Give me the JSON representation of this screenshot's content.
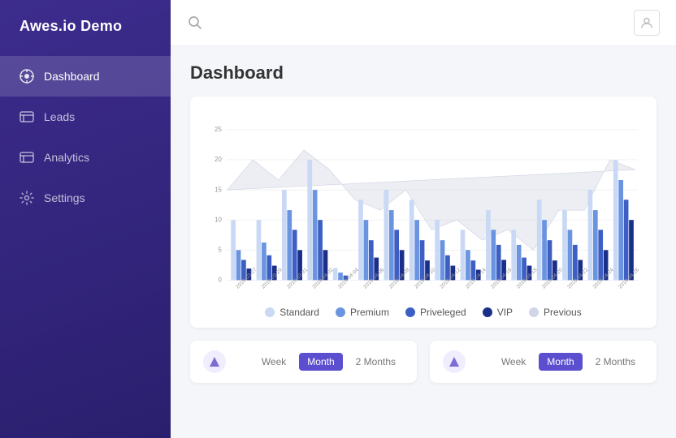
{
  "app": {
    "title": "Awes.io Demo"
  },
  "sidebar": {
    "items": [
      {
        "id": "dashboard",
        "label": "Dashboard",
        "active": true
      },
      {
        "id": "leads",
        "label": "Leads",
        "active": false
      },
      {
        "id": "analytics",
        "label": "Analytics",
        "active": false
      },
      {
        "id": "settings",
        "label": "Settings",
        "active": false
      }
    ]
  },
  "page": {
    "title": "Dashboard"
  },
  "chart": {
    "yAxisLabels": [
      "0",
      "5",
      "10",
      "15",
      "20",
      "25"
    ],
    "xAxisLabels": [
      "2019-03-27",
      "2019-03-29",
      "2019-03-31",
      "2019-04-02",
      "2019-04-04",
      "2019-04-06",
      "2019-04-08",
      "2019-04-10",
      "2019-04-12",
      "2019-04-14",
      "2019-04-16",
      "2019-04-18",
      "2019-04-20",
      "2019-04-22",
      "2019-04-24",
      "2019-04-26"
    ],
    "legend": [
      {
        "label": "Standard",
        "color": "#c9d9f5"
      },
      {
        "label": "Premium",
        "color": "#6b94e0"
      },
      {
        "label": "Priveleged",
        "color": "#3d5fc4"
      },
      {
        "label": "VIP",
        "color": "#1a2f8a"
      },
      {
        "label": "Previous",
        "color": "#e0e4ef"
      }
    ]
  },
  "bottomCards": [
    {
      "periods": [
        "Week",
        "Month",
        "2 Months"
      ],
      "activePeriod": "Month"
    },
    {
      "periods": [
        "Week",
        "Month",
        "2 Months"
      ],
      "activePeriod": "Month"
    }
  ]
}
